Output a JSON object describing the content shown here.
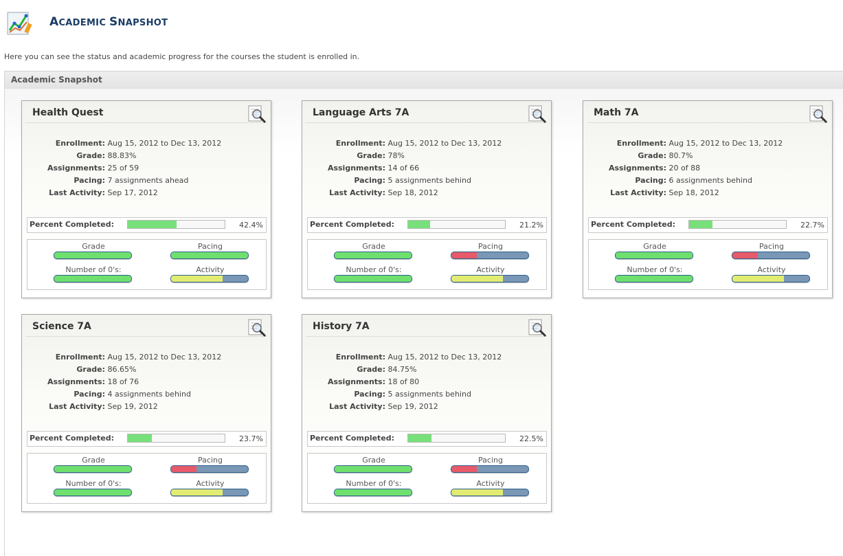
{
  "page": {
    "title_first_big": "A",
    "title_first_rest": "CADEMIC",
    "title_second_big": "S",
    "title_second_rest": "NAPSHOT",
    "intro": "Here you can see the status and academic progress for the courses the student is enrolled in."
  },
  "panel": {
    "title": "Academic Snapshot"
  },
  "labels": {
    "enrollment": "Enrollment:",
    "grade": "Grade:",
    "assignments": "Assignments:",
    "pacing": "Pacing:",
    "last_activity": "Last Activity:",
    "percent_completed": "Percent Completed:",
    "ind_grade": "Grade",
    "ind_pacing": "Pacing",
    "ind_zeros": "Number of 0's:",
    "ind_activity": "Activity"
  },
  "colors": {
    "progress_fill": "#77e07a",
    "indicator_green": "#6fe06e",
    "indicator_red": "#e65a6a",
    "indicator_yellow": "#e3ec72",
    "indicator_track": "#7a97b5",
    "title": "#1a3d66"
  },
  "icons": {
    "app": "chart-icon",
    "card_detail": "magnifier-icon"
  },
  "courses": [
    {
      "title": "Health Quest",
      "enrollment": "Aug 15, 2012 to Dec 13, 2012",
      "grade": "88.83%",
      "assignments": "25 of 59",
      "pacing": "7 assignments ahead",
      "last_activity": "Sep 17, 2012",
      "percent_completed": "42.4%",
      "percent_value": 0.5,
      "indicators": {
        "grade": {
          "color": "green",
          "level": 1.0
        },
        "pacing": {
          "color": "green",
          "level": 1.0
        },
        "zeros": {
          "color": "green",
          "level": 1.0
        },
        "activity": {
          "color": "yellow",
          "level": 0.67
        }
      }
    },
    {
      "title": "Language Arts 7A",
      "enrollment": "Aug 15, 2012 to Dec 13, 2012",
      "grade": "78%",
      "assignments": "14 of 66",
      "pacing": "5 assignments behind",
      "last_activity": "Sep 18, 2012",
      "percent_completed": "21.2%",
      "percent_value": 0.23,
      "indicators": {
        "grade": {
          "color": "green",
          "level": 1.0
        },
        "pacing": {
          "color": "red",
          "level": 0.33
        },
        "zeros": {
          "color": "green",
          "level": 1.0
        },
        "activity": {
          "color": "yellow",
          "level": 0.67
        }
      }
    },
    {
      "title": "Math 7A",
      "enrollment": "Aug 15, 2012 to Dec 13, 2012",
      "grade": "80.7%",
      "assignments": "20 of 88",
      "pacing": "6 assignments behind",
      "last_activity": "Sep 18, 2012",
      "percent_completed": "22.7%",
      "percent_value": 0.24,
      "indicators": {
        "grade": {
          "color": "green",
          "level": 1.0
        },
        "pacing": {
          "color": "red",
          "level": 0.33
        },
        "zeros": {
          "color": "green",
          "level": 1.0
        },
        "activity": {
          "color": "yellow",
          "level": 0.67
        }
      }
    },
    {
      "title": "Science 7A",
      "enrollment": "Aug 15, 2012 to Dec 13, 2012",
      "grade": "86.65%",
      "assignments": "18 of 76",
      "pacing": "4 assignments behind",
      "last_activity": "Sep 19, 2012",
      "percent_completed": "23.7%",
      "percent_value": 0.25,
      "indicators": {
        "grade": {
          "color": "green",
          "level": 1.0
        },
        "pacing": {
          "color": "red",
          "level": 0.33
        },
        "zeros": {
          "color": "green",
          "level": 1.0
        },
        "activity": {
          "color": "yellow",
          "level": 0.67
        }
      }
    },
    {
      "title": "History 7A",
      "enrollment": "Aug 15, 2012 to Dec 13, 2012",
      "grade": "84.75%",
      "assignments": "18 of 80",
      "pacing": "5 assignments behind",
      "last_activity": "Sep 19, 2012",
      "percent_completed": "22.5%",
      "percent_value": 0.24,
      "indicators": {
        "grade": {
          "color": "green",
          "level": 1.0
        },
        "pacing": {
          "color": "red",
          "level": 0.33
        },
        "zeros": {
          "color": "green",
          "level": 1.0
        },
        "activity": {
          "color": "yellow",
          "level": 0.67
        }
      }
    }
  ]
}
